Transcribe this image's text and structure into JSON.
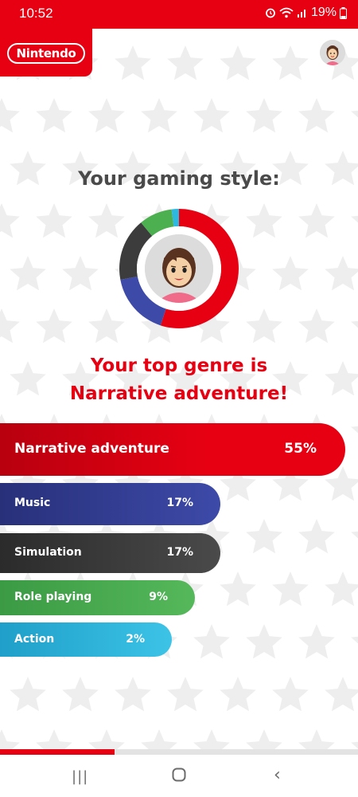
{
  "status_bar": {
    "time": "10:52",
    "battery": "19%",
    "icons": [
      "alarm-icon",
      "wifi-icon",
      "signal-icon",
      "battery-icon"
    ]
  },
  "header": {
    "logo_text": "Nintendo",
    "avatar": "mii-avatar"
  },
  "main": {
    "heading": "Your gaming style:",
    "top_genre_line1": "Your top genre is",
    "top_genre_line2": "Narrative adventure!"
  },
  "chart_data": {
    "type": "pie",
    "categories": [
      "Narrative adventure",
      "Music",
      "Simulation",
      "Role playing",
      "Action"
    ],
    "values": [
      55,
      17,
      17,
      9,
      2
    ],
    "colors": [
      "#e60012",
      "#3d4aa8",
      "#3c3c3c",
      "#4caf50",
      "#2eb8e0"
    ]
  },
  "genres": [
    {
      "label": "Narrative adventure",
      "percent": "55%"
    },
    {
      "label": "Music",
      "percent": "17%"
    },
    {
      "label": "Simulation",
      "percent": "17%"
    },
    {
      "label": "Role playing",
      "percent": "9%"
    },
    {
      "label": "Action",
      "percent": "2%"
    }
  ],
  "progress": {
    "value": 0.32
  },
  "nav": {
    "recents_icon": "|||",
    "home_icon": "home-icon",
    "back_icon": "‹"
  },
  "colors": {
    "brand_red": "#e60012",
    "heading_gray": "#4a4a4a"
  }
}
